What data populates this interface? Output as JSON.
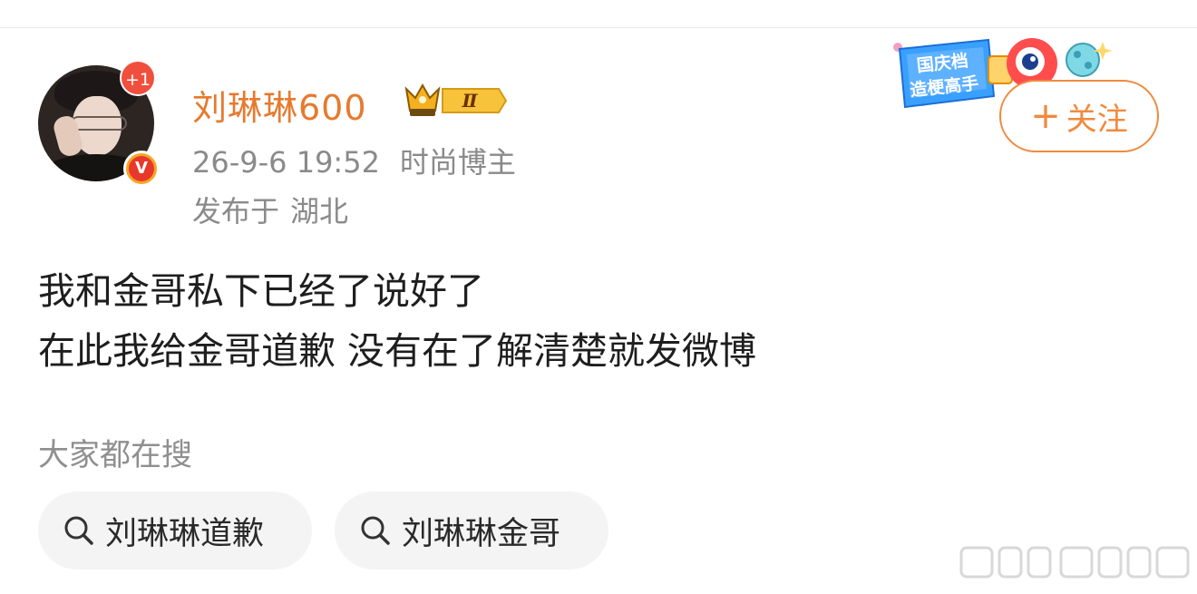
{
  "author": {
    "name": "刘琳琳600",
    "notification_count": "+1",
    "verified_mark": "V",
    "level_badge": "Ⅱ",
    "timestamp": "26-9-6 19:52",
    "category": "时尚博主",
    "location_prefix": "发布于",
    "location": "湖北"
  },
  "promo_badge": {
    "line1": "国庆档",
    "line2": "造梗高手"
  },
  "follow_button": {
    "plus": "+",
    "label": "关注"
  },
  "post": {
    "lines": [
      "我和金哥私下已经了说好了",
      "在此我给金哥道歉 没有在了解清楚就发微博"
    ]
  },
  "trending": {
    "heading": "大家都在搜",
    "chips": [
      {
        "label": "刘琳琳道歉",
        "icon": "search-icon"
      },
      {
        "label": "刘琳琳金哥",
        "icon": "search-icon"
      }
    ]
  },
  "colors": {
    "accent_orange": "#f08a3e",
    "username_orange": "#e67a2e",
    "meta_gray": "#8a8a8a",
    "chip_bg": "#f4f4f4",
    "badge_red": "#f14f3d"
  }
}
